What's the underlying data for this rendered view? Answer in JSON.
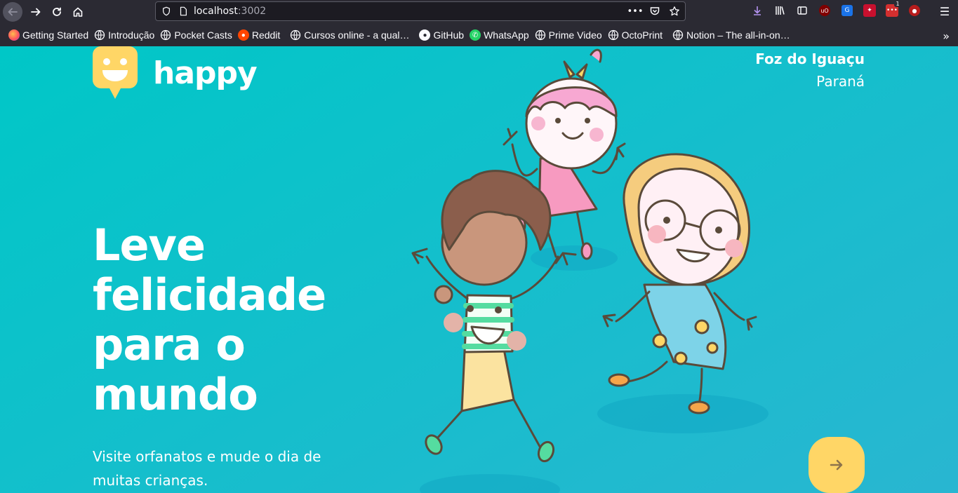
{
  "browser": {
    "url_host": "localhost",
    "url_port": ":3002",
    "bookmarks": [
      {
        "label": "Getting Started",
        "icon": "firefox-icon"
      },
      {
        "label": "Introdução",
        "icon": "globe-icon"
      },
      {
        "label": "Pocket Casts",
        "icon": "globe-icon"
      },
      {
        "label": "Reddit",
        "icon": "reddit-icon"
      },
      {
        "label": "Cursos online - a qual…",
        "icon": "globe-icon"
      },
      {
        "label": "GitHub",
        "icon": "github-icon"
      },
      {
        "label": "WhatsApp",
        "icon": "whatsapp-icon"
      },
      {
        "label": "Prime Video",
        "icon": "globe-icon"
      },
      {
        "label": "OctoPrint",
        "icon": "globe-icon"
      },
      {
        "label": "Notion – The all-in-on…",
        "icon": "globe-icon"
      }
    ],
    "extension_badge": "1"
  },
  "page": {
    "logo_text": "happy",
    "city": "Foz do Iguaçu",
    "state": "Paraná",
    "headline_lines": [
      "Leve",
      "felicidade",
      "para o",
      "mundo"
    ],
    "subtitle": "Visite orfanatos e mude o dia de muitas crianças.",
    "enter_icon": "arrow-right-icon",
    "colors": {
      "gradient_start": "#00c7c7",
      "gradient_end": "#29b6d1",
      "accent_yellow": "#ffd666"
    }
  }
}
